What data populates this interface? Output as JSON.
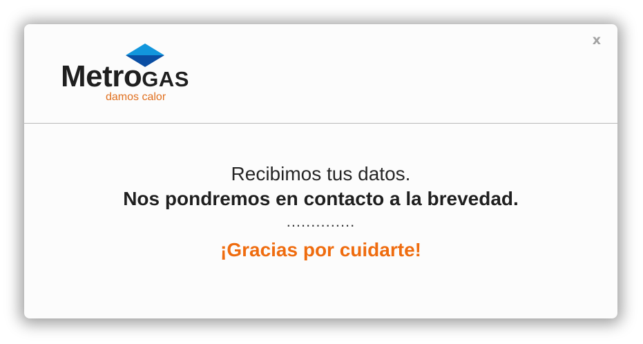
{
  "modal": {
    "close_label": "x",
    "brand": {
      "name_regular": "Metro",
      "name_caps": "GAS",
      "tagline": "damos calor",
      "colors": {
        "diamond_light": "#1296dc",
        "diamond_dark": "#0a4ea3",
        "tagline": "#e0701f"
      }
    },
    "message": {
      "line1": "Recibimos tus datos.",
      "line2": "Nos pondremos en contacto a la brevedad.",
      "dots": "..............",
      "thanks": "¡Gracias por cuidarte!"
    },
    "accent_color": "#ef6c0f"
  }
}
